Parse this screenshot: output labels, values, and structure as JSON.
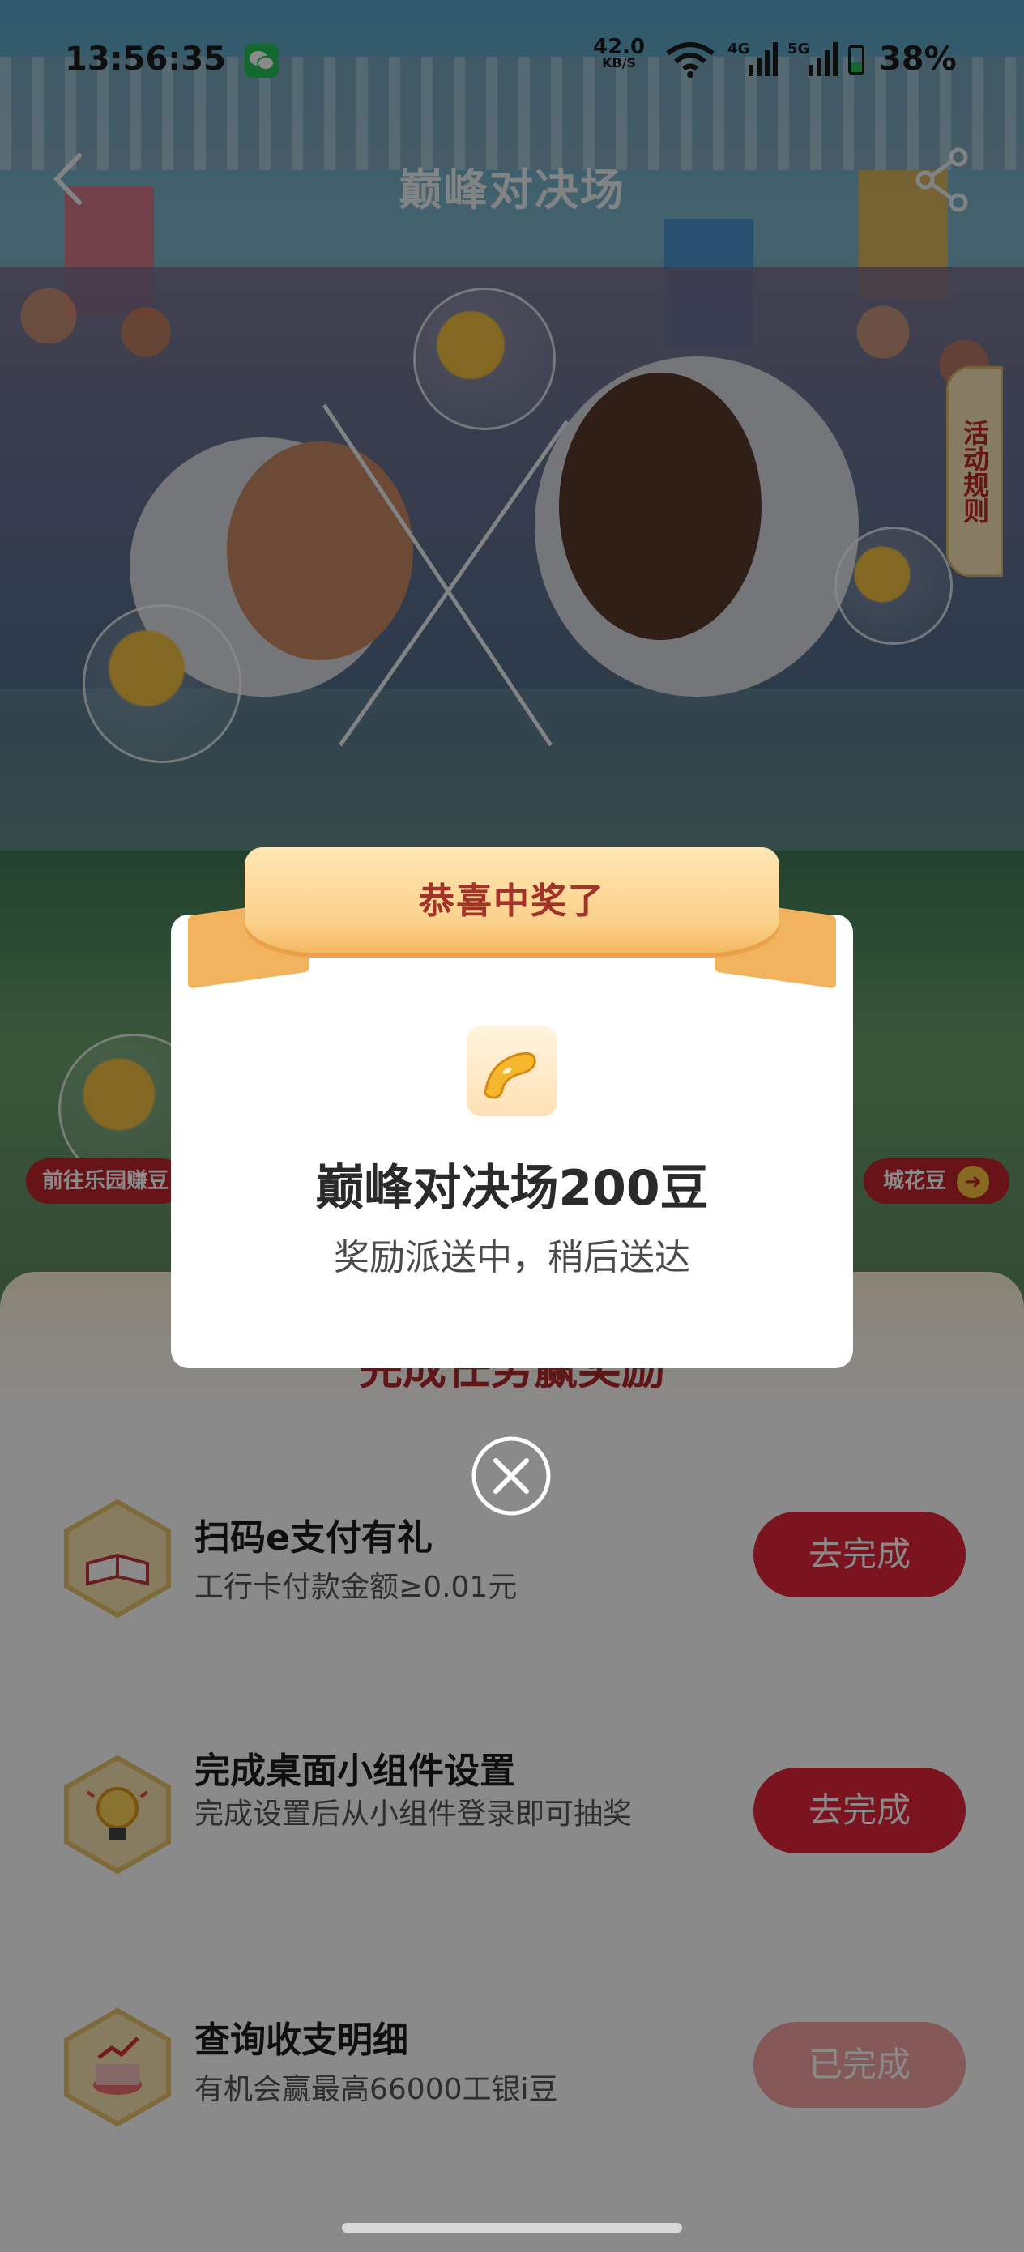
{
  "status_bar": {
    "time": "13:56:35",
    "net_speed": "42.0",
    "net_unit": "KB/S",
    "sim1_label": "4G",
    "sim2_label": "5G",
    "battery": "38%"
  },
  "nav": {
    "title": "巅峰对决场",
    "rules_tab": "活动规则"
  },
  "banner": {
    "left_pill": "前往乐园赚豆",
    "right_pill": "城花豆"
  },
  "panel": {
    "title": "完成任务赢奖励",
    "tasks": [
      {
        "title": "扫码e支付有礼",
        "subtitle": "工行卡付款金额≥0.01元",
        "button": "去完成",
        "icon": "book-icon",
        "status": "todo"
      },
      {
        "title": "完成桌面小组件设置",
        "subtitle": "完成设置后从小组件登录即可抽奖",
        "button": "去完成",
        "icon": "lightbulb-icon",
        "status": "todo"
      },
      {
        "title": "查询收支明细",
        "subtitle": "有机会赢最高66000工银i豆",
        "button": "已完成",
        "icon": "chart-icon",
        "status": "done"
      }
    ]
  },
  "modal": {
    "ribbon": "恭喜中奖了",
    "prize_title": "巅峰对决场200豆",
    "prize_subtitle": "奖励派送中，稍后送达",
    "prize_icon": "bean-icon",
    "close_icon": "close-icon"
  },
  "colors": {
    "accent_red": "#e5263a",
    "done_pink": "#f4a5a3",
    "ribbon_gold": "#fbd18a"
  }
}
